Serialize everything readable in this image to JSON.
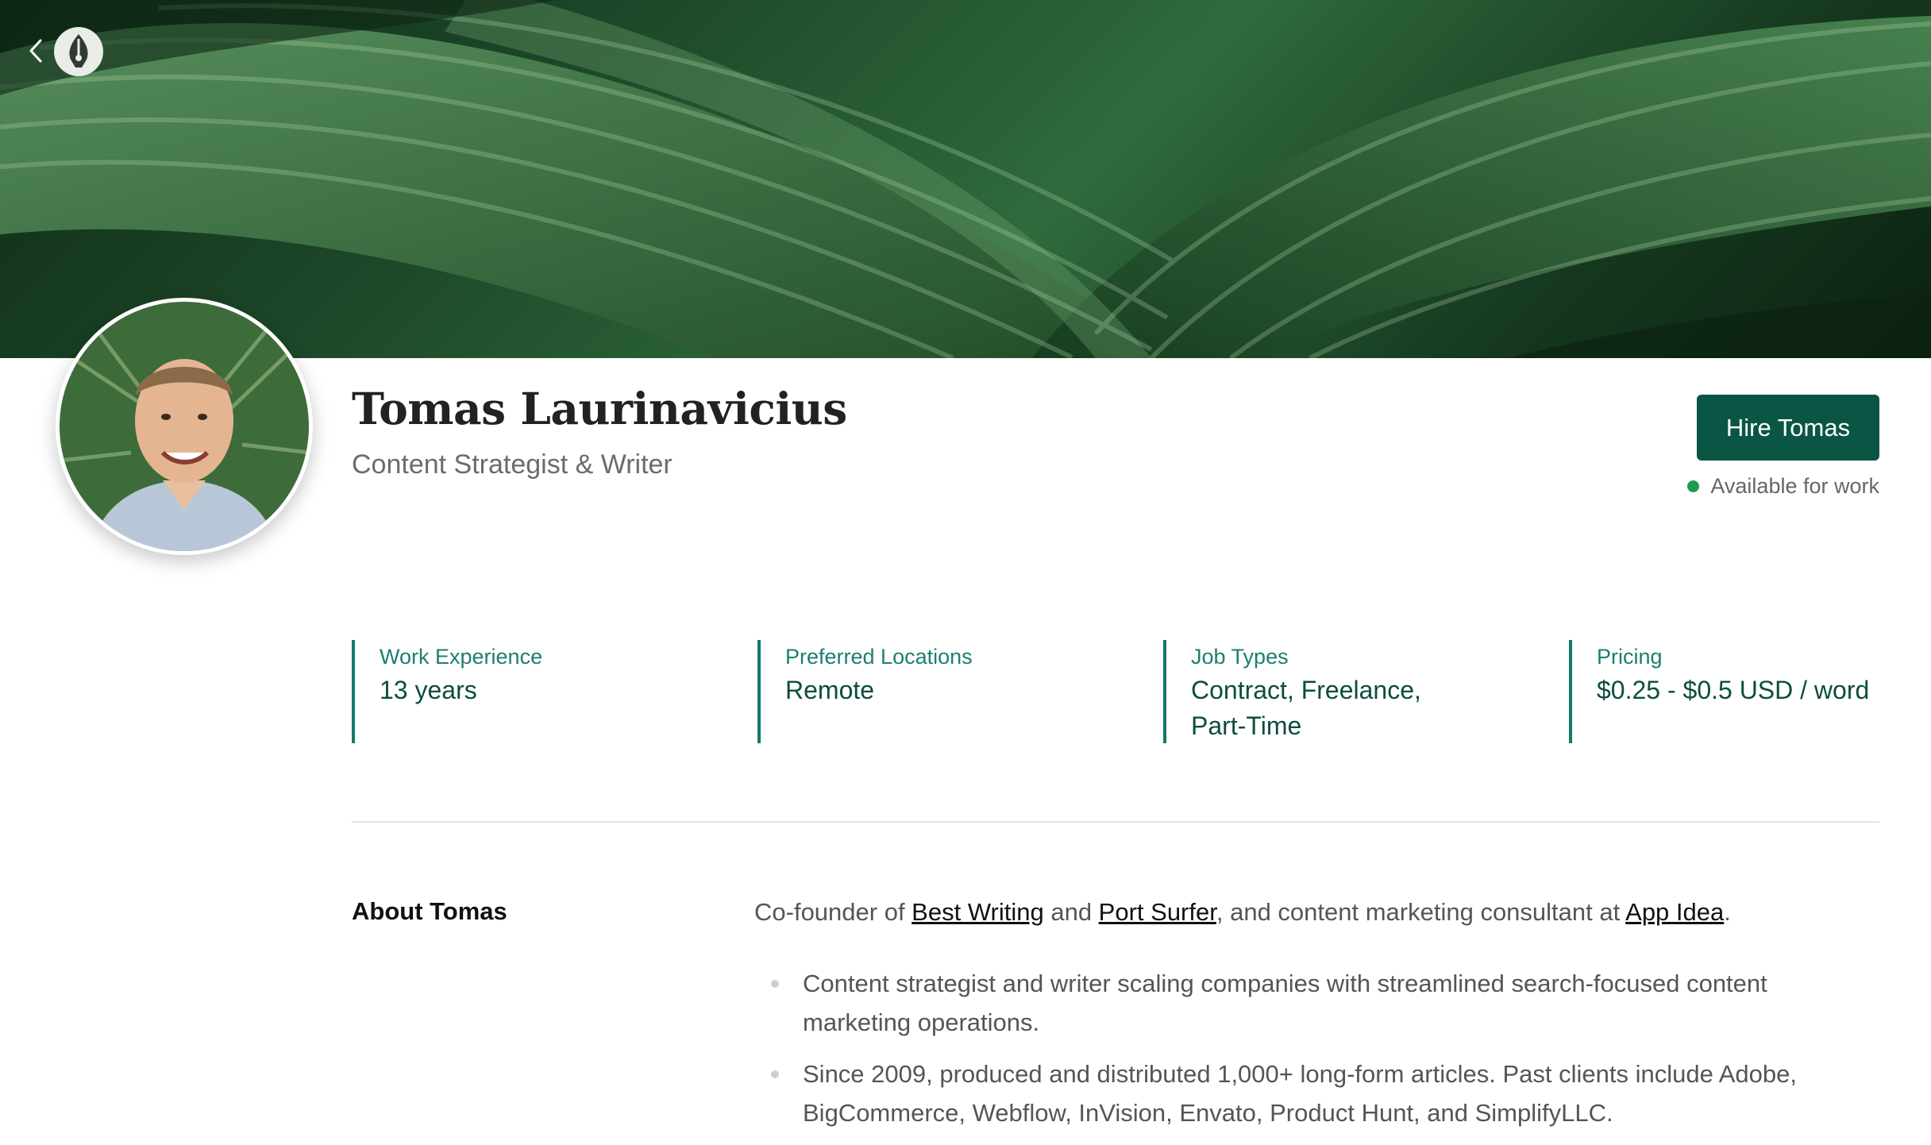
{
  "banner": {
    "image": "tropical-leaves-banner"
  },
  "nav": {
    "back_icon": "chevron-left-icon",
    "logo_icon": "pen-nib-icon"
  },
  "profile": {
    "avatar_icon": "avatar-photo",
    "name": "Tomas Laurinavicius",
    "title": "Content Strategist & Writer",
    "hire_label": "Hire Tomas",
    "availability": "Available for work",
    "availability_color": "#1f9b4f",
    "accent_color": "#0b5545"
  },
  "stats": [
    {
      "label": "Work Experience",
      "value": "13 years"
    },
    {
      "label": "Preferred Locations",
      "value": "Remote"
    },
    {
      "label": "Job Types",
      "value": "Contract, Freelance, Part-Time"
    },
    {
      "label": "Pricing",
      "value": "$0.25 - $0.5 USD / word"
    }
  ],
  "about": {
    "heading": "About Tomas",
    "intro": {
      "t1": "Co-founder of ",
      "link1": "Best Writing",
      "t2": " and ",
      "link2": "Port Surfer",
      "t3": ", and content marketing consultant at ",
      "link3": "App Idea",
      "t4": "."
    },
    "bullets": [
      "Content strategist and writer scaling companies with streamlined search-focused content marketing operations.",
      "Since 2009, produced and distributed 1,000+ long-form articles. Past clients include Adobe, BigCommerce, Webflow, InVision, Envato, Product Hunt, and SimplifyLLC."
    ]
  }
}
